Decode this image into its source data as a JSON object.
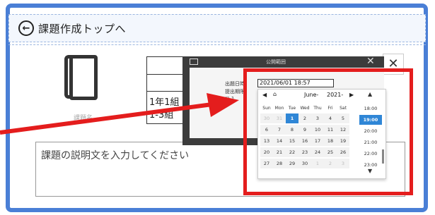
{
  "header": {
    "back_icon": "back-circle-icon",
    "back_glyph": "←",
    "title": "課題作成トップへ"
  },
  "left": {
    "book_icon": "book-icon",
    "book_caption": "課題名"
  },
  "info_table": {
    "class_line1": "1年1組",
    "class_line2": "1-3組"
  },
  "description": {
    "placeholder": "課題の説明文を入力してください"
  },
  "behind": {
    "close_glyph": "✕"
  },
  "modal": {
    "title": "公開範囲",
    "close_glyph": "✕",
    "label_publish_datetime": "出題日時：",
    "label_deadline": "提出期限：",
    "label_checkbox": "□ 1",
    "datetime_value": "2021/06/01 18:57"
  },
  "picker": {
    "prev": "◀",
    "home": "⌂",
    "next": "▶",
    "month": "June-",
    "year": "2021-",
    "weekdays": [
      "Sun",
      "Mon",
      "Tue",
      "Wed",
      "Thu",
      "Fri",
      "Sat"
    ],
    "days": [
      [
        "30",
        "31",
        "1",
        "2",
        "3",
        "4",
        "5"
      ],
      [
        "6",
        "7",
        "8",
        "9",
        "10",
        "11",
        "12"
      ],
      [
        "13",
        "14",
        "15",
        "16",
        "17",
        "18",
        "19"
      ],
      [
        "20",
        "21",
        "22",
        "23",
        "24",
        "25",
        "26"
      ],
      [
        "27",
        "28",
        "29",
        "30",
        "1",
        "2",
        "3"
      ]
    ],
    "selected_day": "1",
    "time_up": "▲",
    "time_down": "▼",
    "times": [
      "18:00",
      "19:00",
      "20:00",
      "21:00",
      "22:00",
      "23:00"
    ],
    "selected_time": "19:00"
  },
  "colors": {
    "accent": "#2f86d6",
    "highlight": "#e41d1d",
    "frame": "#4a7fd6"
  }
}
